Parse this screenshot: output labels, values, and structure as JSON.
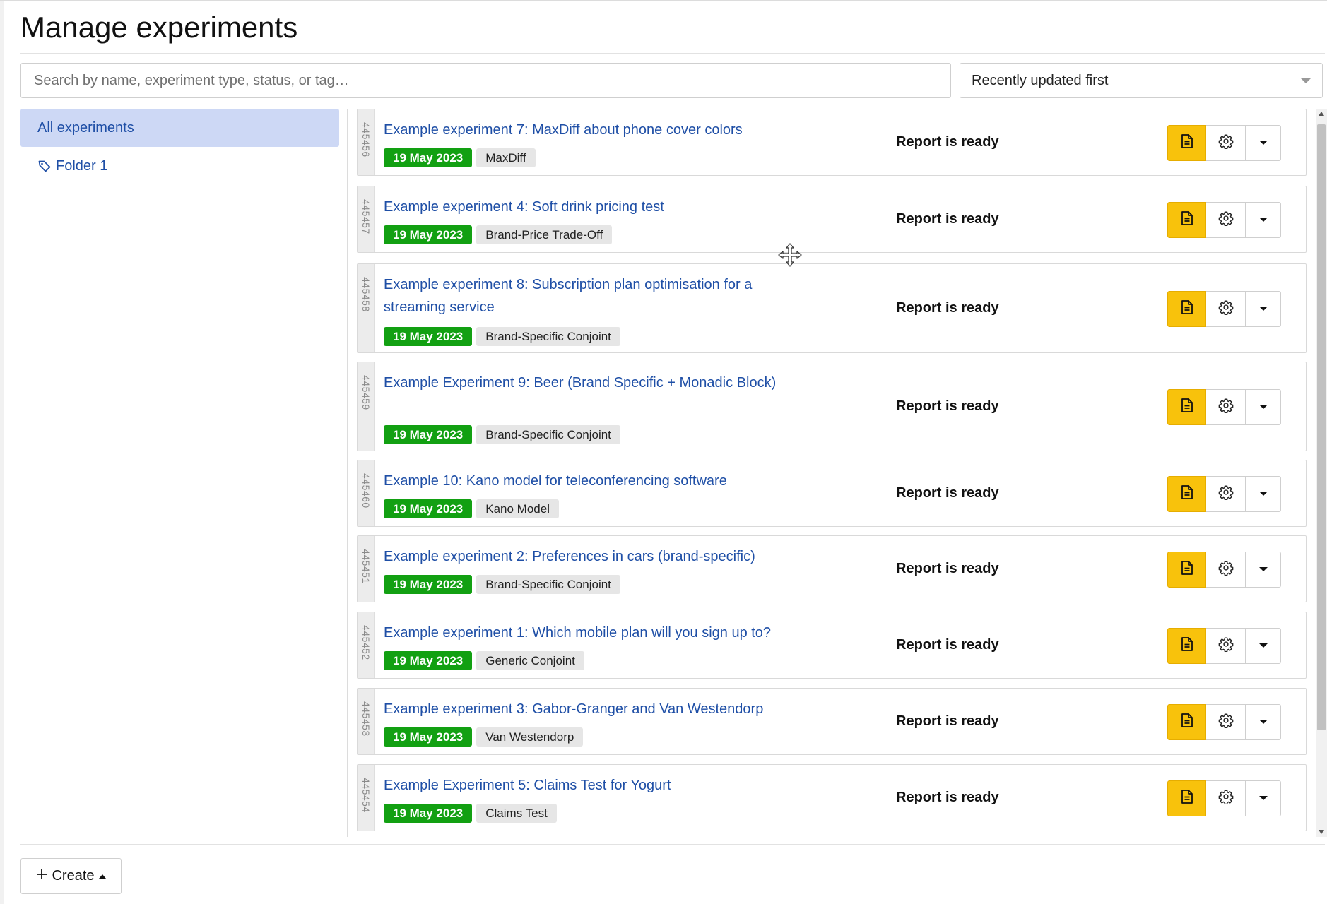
{
  "page": {
    "title": "Manage experiments"
  },
  "search": {
    "placeholder": "Search by name, experiment type, status, or tag…",
    "value": ""
  },
  "sort": {
    "selected": "Recently updated first"
  },
  "sidebar": {
    "items": [
      {
        "label": "All experiments",
        "active": true,
        "icon": ""
      },
      {
        "label": "Folder 1",
        "active": false,
        "icon": "tag-icon"
      }
    ]
  },
  "experiments": [
    {
      "id": "445456",
      "title": "Example experiment 7: MaxDiff about phone cover colors",
      "date": "19 May 2023",
      "type": "MaxDiff",
      "status": "Report is ready"
    },
    {
      "id": "445457",
      "title": "Example experiment 4: Soft drink pricing test",
      "date": "19 May 2023",
      "type": "Brand-Price Trade-Off",
      "status": "Report is ready"
    },
    {
      "id": "445458",
      "title": "Example experiment 8: Subscription plan optimisation for a streaming service",
      "date": "19 May 2023",
      "type": "Brand-Specific Conjoint",
      "status": "Report is ready"
    },
    {
      "id": "445459",
      "title": "Example Experiment 9: Beer (Brand Specific + Monadic Block)",
      "date": "19 May 2023",
      "type": "Brand-Specific Conjoint",
      "status": "Report is ready"
    },
    {
      "id": "445460",
      "title": "Example 10: Kano model for teleconferencing software",
      "date": "19 May 2023",
      "type": "Kano Model",
      "status": "Report is ready"
    },
    {
      "id": "445451",
      "title": "Example experiment 2: Preferences in cars (brand-specific)",
      "date": "19 May 2023",
      "type": "Brand-Specific Conjoint",
      "status": "Report is ready"
    },
    {
      "id": "445452",
      "title": "Example experiment 1: Which mobile plan will you sign up to?",
      "date": "19 May 2023",
      "type": "Generic Conjoint",
      "status": "Report is ready"
    },
    {
      "id": "445453",
      "title": "Example experiment 3: Gabor-Granger and Van Westendorp",
      "date": "19 May 2023",
      "type": "Van Westendorp",
      "status": "Report is ready"
    },
    {
      "id": "445454",
      "title": "Example Experiment 5: Claims Test for Yogurt",
      "date": "19 May 2023",
      "type": "Claims Test",
      "status": "Report is ready"
    }
  ],
  "actions": {
    "report_icon": "document-icon",
    "settings_icon": "gear-icon",
    "more_icon": "caret-down-icon"
  },
  "footer": {
    "create_label": "Create"
  },
  "colors": {
    "accent": "#f8c20c",
    "date_badge": "#12a012",
    "link": "#1f4fa6",
    "sidebar_active": "#cdd8f5"
  }
}
